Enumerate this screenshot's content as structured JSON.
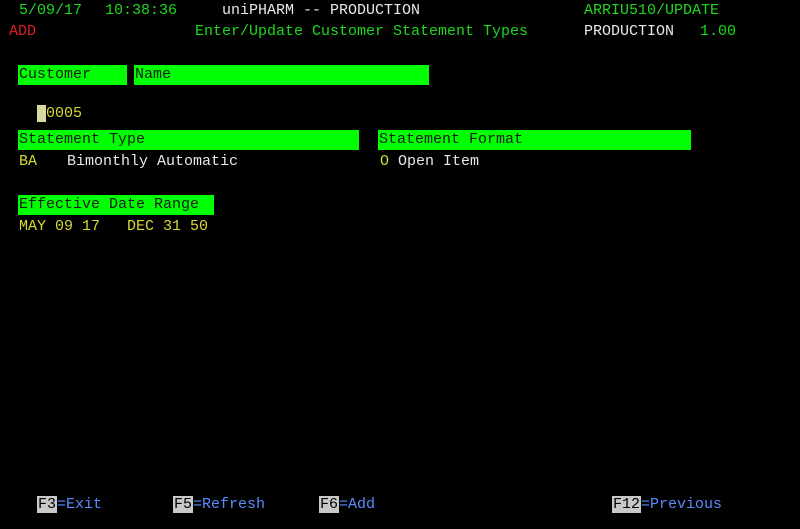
{
  "status_line": {
    "date": "5/09/17",
    "time": "10:38:36",
    "system": "uniPHARM -- PRODUCTION",
    "program": "ARRIU510/UPDATE"
  },
  "title_line": {
    "mode": "ADD",
    "title": "Enter/Update Customer Statement Types",
    "environment": "PRODUCTION",
    "version": "1.00"
  },
  "customer_section": {
    "customer_header": "Customer",
    "name_header": "Name",
    "customer_cursor_char": "",
    "customer_value": "0005",
    "name_value": ""
  },
  "statement_section": {
    "type_header": "Statement Type",
    "type_code": "BA",
    "type_description": "Bimonthly Automatic",
    "format_header": "Statement Format",
    "format_code": "O",
    "format_description": "Open Item"
  },
  "date_section": {
    "header": "Effective Date Range",
    "from_date": "MAY 09 17",
    "to_date": "DEC 31 50"
  },
  "function_keys": [
    {
      "key": "F3",
      "label": "=Exit"
    },
    {
      "key": "F5",
      "label": "=Refresh"
    },
    {
      "key": "F6",
      "label": "=Add"
    },
    {
      "key": "F12",
      "label": "=Previous"
    }
  ],
  "colors": {
    "screen_background": "#000000",
    "header_field_background": "#00ff00",
    "green_text": "#1ed91e",
    "yellow_text": "#d8d832",
    "white_text": "#e8e8e8",
    "red_text": "#e02020",
    "fkey_label": "#5a8cff"
  }
}
